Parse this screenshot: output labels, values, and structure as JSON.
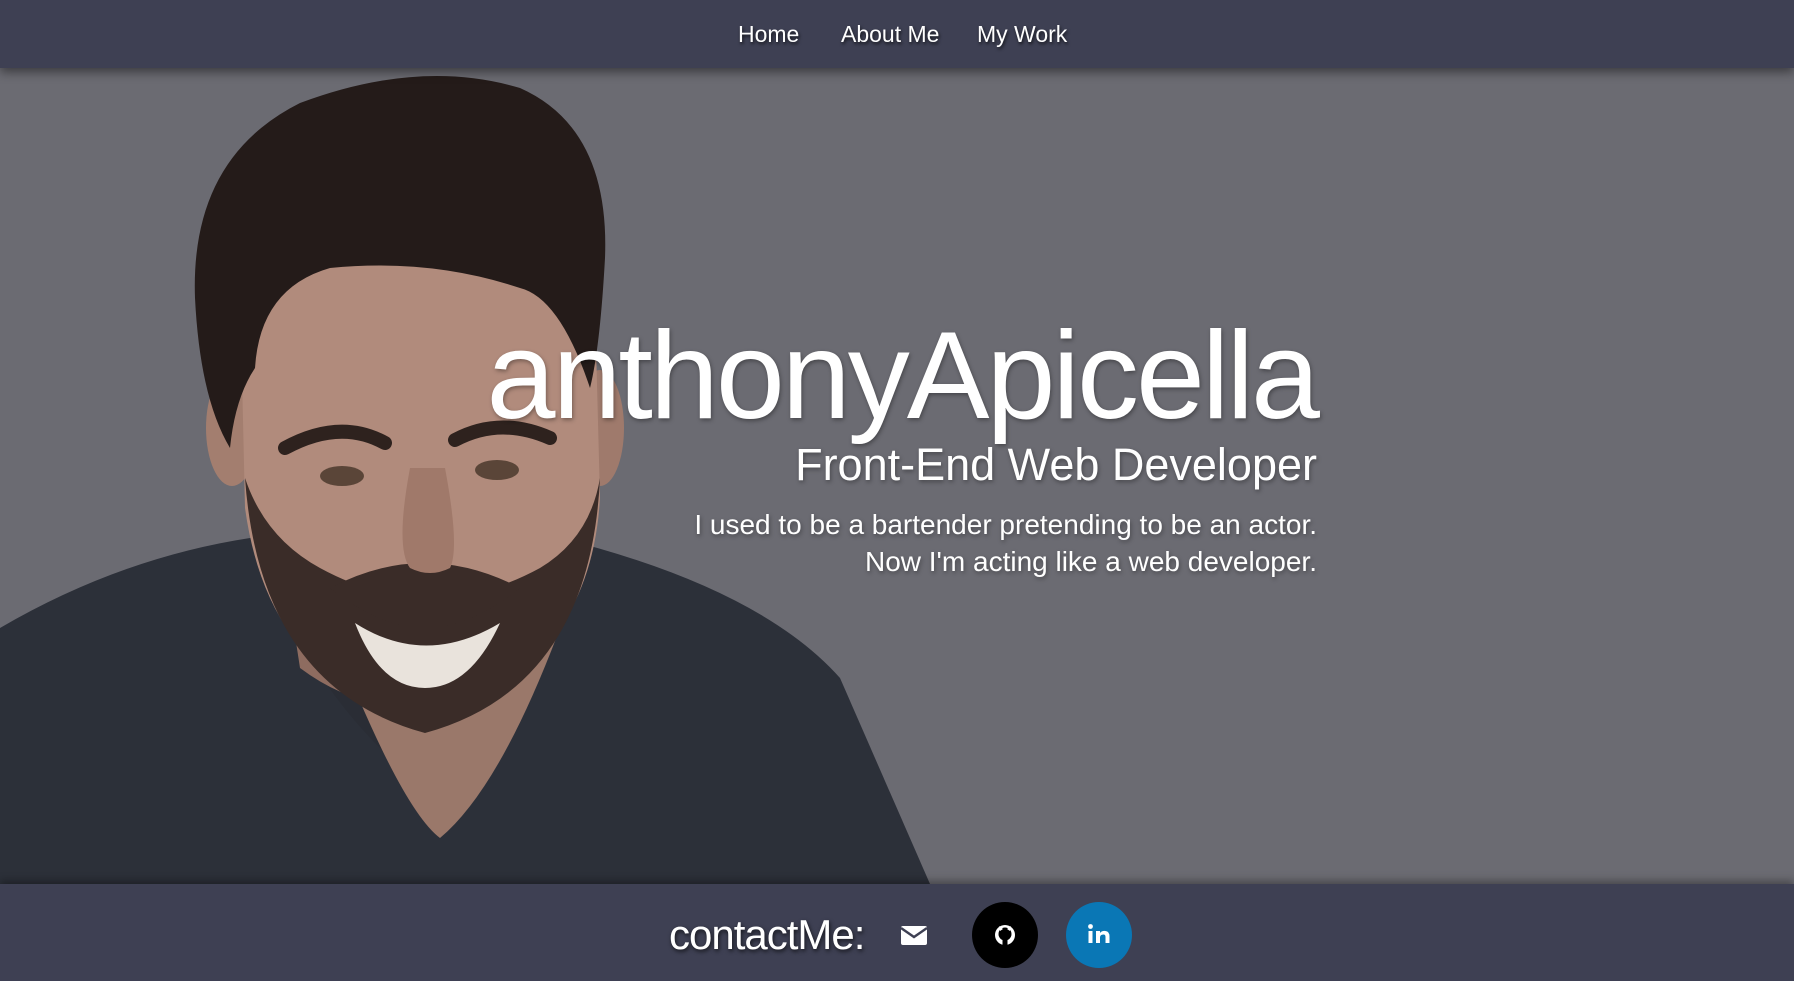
{
  "nav": {
    "links": [
      {
        "label": "Home"
      },
      {
        "label": "About Me"
      },
      {
        "label": "My Work"
      }
    ]
  },
  "hero": {
    "name": "anthonyApicella",
    "role": "Front-End Web Developer",
    "bio_line1": "I used to be a bartender pretending to be an actor.",
    "bio_line2": "Now I'm acting like a web developer."
  },
  "footer": {
    "contact_label": "contactMe:",
    "links": [
      {
        "icon": "envelope-icon"
      },
      {
        "icon": "github-icon"
      },
      {
        "icon": "linkedin-icon"
      }
    ]
  },
  "colors": {
    "nav_bg": "#3e4053",
    "hero_overlay": "#6b6b72",
    "github": "#000000",
    "linkedin": "#0a77b5",
    "text": "#ffffff"
  }
}
